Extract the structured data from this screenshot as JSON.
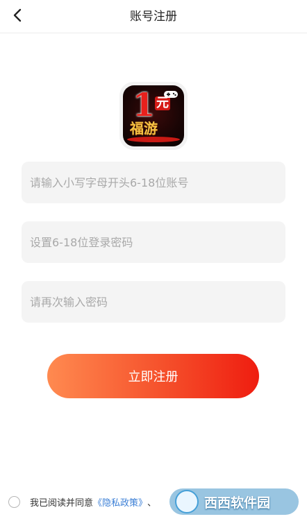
{
  "header": {
    "title": "账号注册",
    "back_icon": "chevron-left-icon"
  },
  "logo": {
    "big_text": "1",
    "small_text": "元",
    "sub_text": "福游",
    "gamepad_icon": "gamepad-icon"
  },
  "form": {
    "username_placeholder": "请输入小写字母开头6-18位账号",
    "password_placeholder": "设置6-18位登录密码",
    "confirm_placeholder": "请再次输入密码",
    "username_value": "",
    "password_value": "",
    "confirm_value": ""
  },
  "submit": {
    "label": "立即注册"
  },
  "agreement": {
    "prefix": "我已阅读并同意",
    "privacy_link": "《隐私政策》",
    "separator": "、"
  },
  "watermark": {
    "text": "西西软件园"
  },
  "colors": {
    "accent_start": "#ff8a50",
    "accent_end": "#ef1d10",
    "link": "#3b7fd6",
    "field_bg": "#f4f4f4"
  }
}
